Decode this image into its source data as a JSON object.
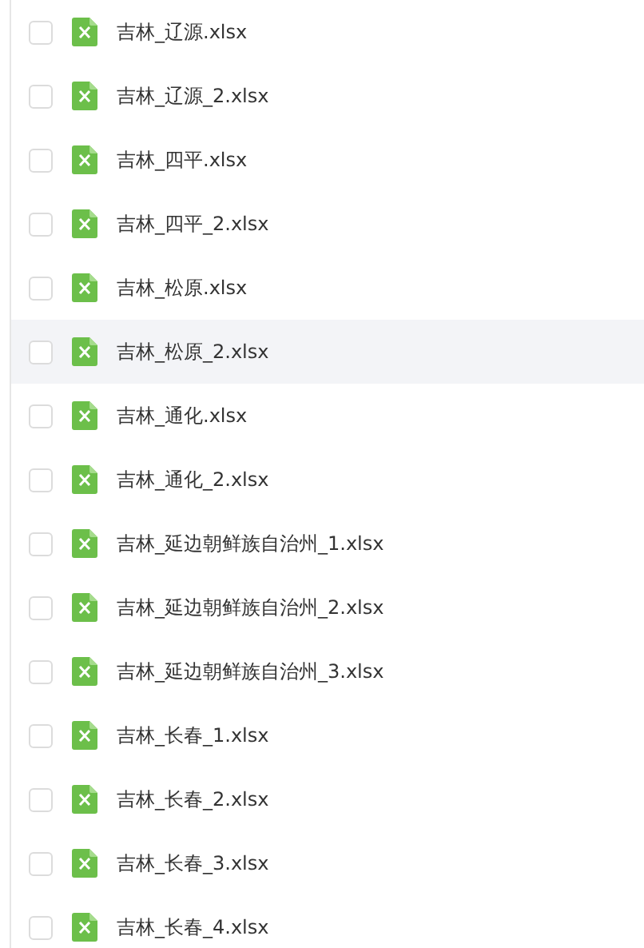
{
  "files": [
    {
      "name": "吉林_辽源.xlsx",
      "checked": false,
      "highlighted": false
    },
    {
      "name": "吉林_辽源_2.xlsx",
      "checked": false,
      "highlighted": false
    },
    {
      "name": "吉林_四平.xlsx",
      "checked": false,
      "highlighted": false
    },
    {
      "name": "吉林_四平_2.xlsx",
      "checked": false,
      "highlighted": false
    },
    {
      "name": "吉林_松原.xlsx",
      "checked": false,
      "highlighted": false
    },
    {
      "name": "吉林_松原_2.xlsx",
      "checked": false,
      "highlighted": true
    },
    {
      "name": "吉林_通化.xlsx",
      "checked": false,
      "highlighted": false
    },
    {
      "name": "吉林_通化_2.xlsx",
      "checked": false,
      "highlighted": false
    },
    {
      "name": "吉林_延边朝鲜族自治州_1.xlsx",
      "checked": false,
      "highlighted": false
    },
    {
      "name": "吉林_延边朝鲜族自治州_2.xlsx",
      "checked": false,
      "highlighted": false
    },
    {
      "name": "吉林_延边朝鲜族自治州_3.xlsx",
      "checked": false,
      "highlighted": false
    },
    {
      "name": "吉林_长春_1.xlsx",
      "checked": false,
      "highlighted": false
    },
    {
      "name": "吉林_长春_2.xlsx",
      "checked": false,
      "highlighted": false
    },
    {
      "name": "吉林_长春_3.xlsx",
      "checked": false,
      "highlighted": false
    },
    {
      "name": "吉林_长春_4.xlsx",
      "checked": false,
      "highlighted": false
    }
  ]
}
